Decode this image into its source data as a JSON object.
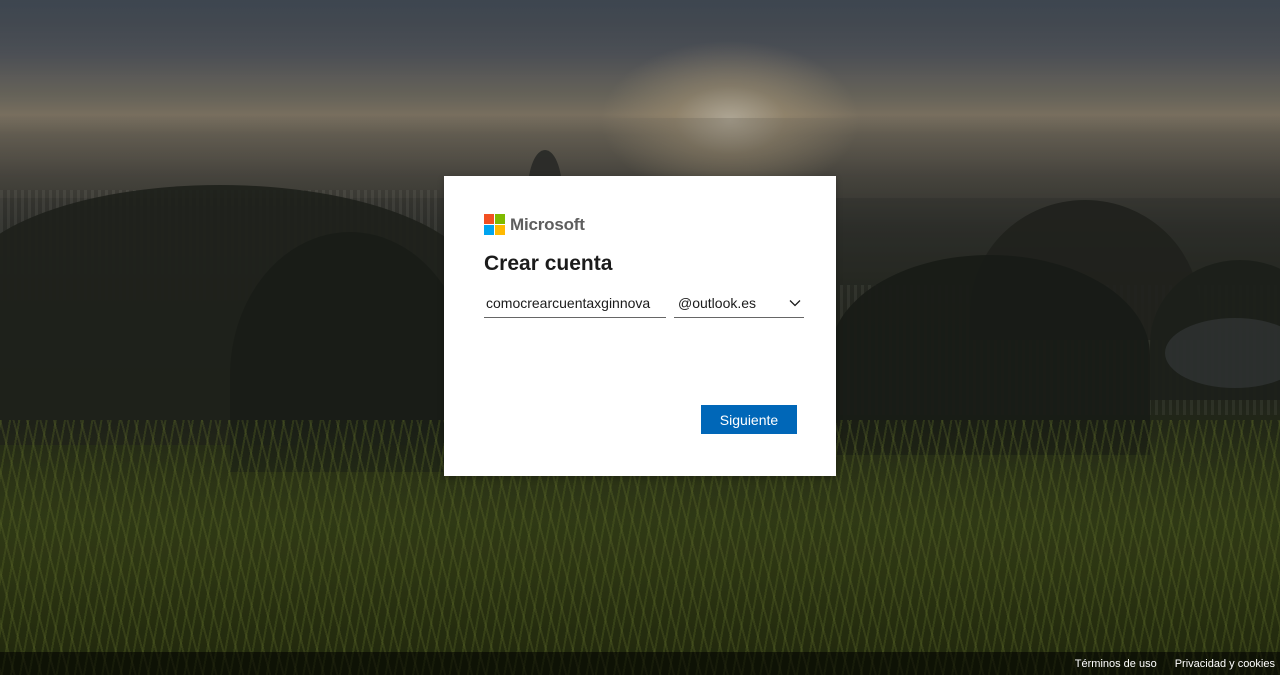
{
  "brand": {
    "name": "Microsoft",
    "colors": {
      "red": "#f25022",
      "green": "#7fba00",
      "blue": "#00a4ef",
      "yellow": "#ffb900"
    }
  },
  "dialog": {
    "title": "Crear cuenta",
    "username_value": "comocrearcuentaxginnova",
    "domain_selected": "@outlook.es",
    "next_label": "Siguiente",
    "accent_color": "#0067b8"
  },
  "footer": {
    "terms_label": "Términos de uso",
    "privacy_label": "Privacidad y cookies"
  },
  "icons": {
    "dropdown": "chevron-down-icon",
    "logo": "microsoft-logo-icon"
  }
}
